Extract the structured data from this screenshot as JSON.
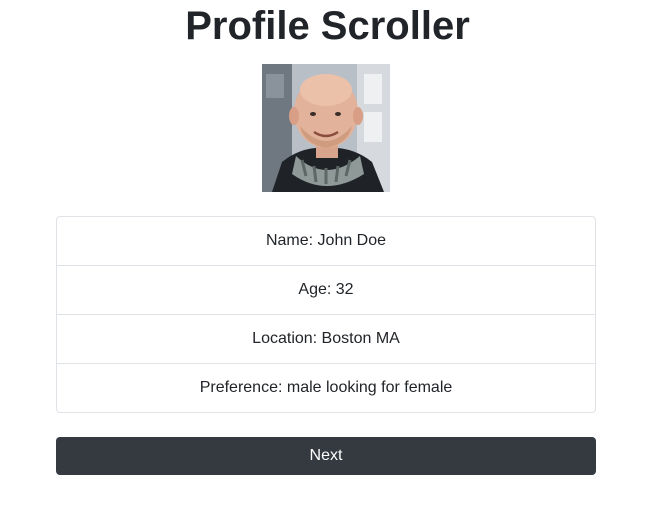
{
  "page": {
    "title": "Profile Scroller"
  },
  "profile": {
    "image_alt": "profile-photo",
    "fields": [
      {
        "text": "Name: John Doe"
      },
      {
        "text": "Age: 32"
      },
      {
        "text": "Location: Boston MA"
      },
      {
        "text": "Preference: male looking for female"
      }
    ]
  },
  "actions": {
    "next_label": "Next"
  },
  "colors": {
    "button_bg": "#343a40",
    "border": "#dfe2e6",
    "text": "#212529"
  }
}
